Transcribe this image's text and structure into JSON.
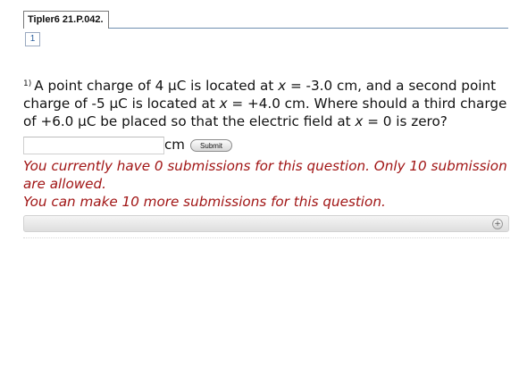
{
  "header": {
    "tab_label": "Tipler6 21.P.042.",
    "part_link": "1"
  },
  "question": {
    "number": "1)",
    "seg1": "A point charge of 4 µC is located at ",
    "var1": "x",
    "seg2": " = -3.0 cm, and a second point charge of -5 µC is located at ",
    "var2": "x",
    "seg3": " = +4.0 cm. Where should a third charge of +6.0 µC be placed so that the electric field at ",
    "var3": "x",
    "seg4": " = 0 is zero?"
  },
  "answer": {
    "value": "",
    "placeholder": "",
    "unit": "cm",
    "submit_label": "Submit"
  },
  "messages": {
    "submissions": "You currently have 0 submissions for this question. Only 10 submission are allowed.",
    "remaining": "You can make 10 more submissions for this question."
  },
  "panel": {
    "expand_glyph": "+"
  },
  "icons": {
    "expand": "plus-circle-icon"
  },
  "colors": {
    "message_red": "#a11515",
    "link_blue": "#2b5f9e"
  }
}
